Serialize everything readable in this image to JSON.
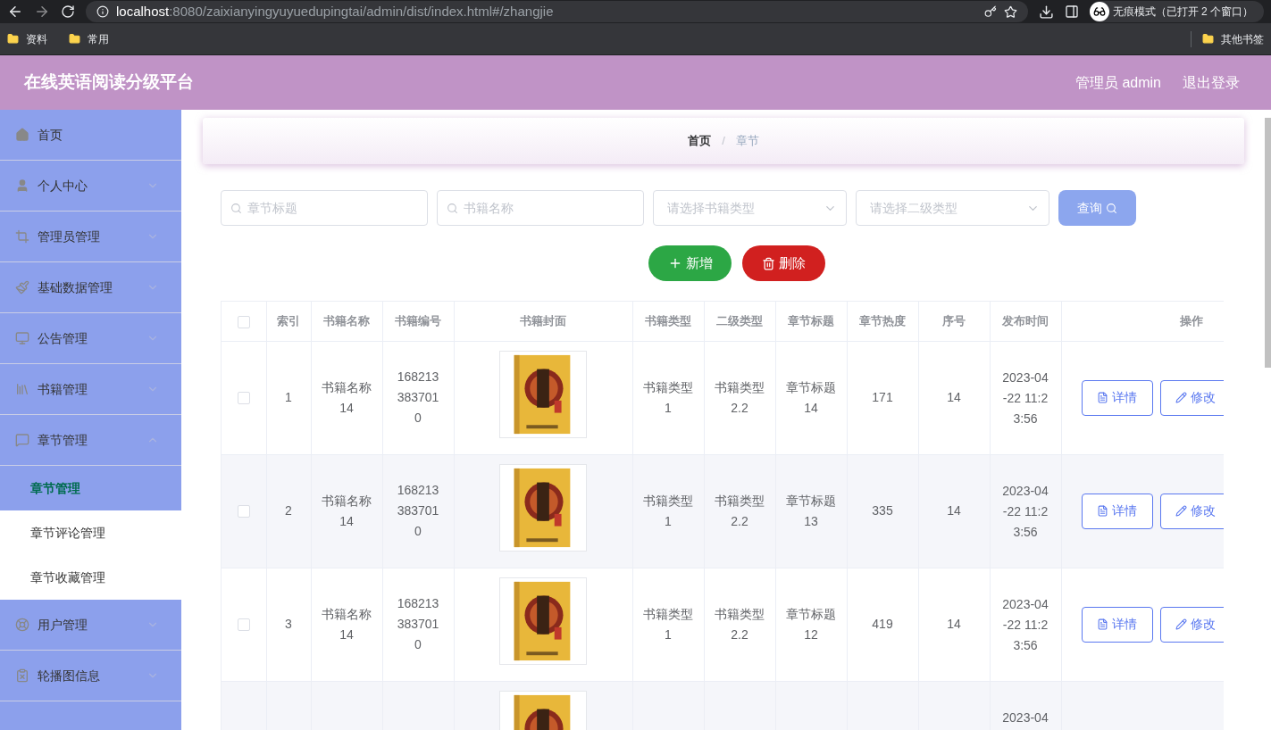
{
  "browser": {
    "url_host": "localhost",
    "url_rest": ":8080/zaixianyingyuyuedupingtai/admin/dist/index.html#/zhangjie",
    "incognito": "无痕模式（已打开 2 个窗口）",
    "bookmarks": [
      "资料",
      "常用"
    ],
    "other_bookmarks": "其他书签"
  },
  "header": {
    "title": "在线英语阅读分级平台",
    "user": "管理员 admin",
    "logout": "退出登录"
  },
  "sidebar": {
    "items": [
      {
        "label": "首页"
      },
      {
        "label": "个人中心",
        "expanded": false
      },
      {
        "label": "管理员管理",
        "expanded": false
      },
      {
        "label": "基础数据管理",
        "expanded": false
      },
      {
        "label": "公告管理",
        "expanded": false
      },
      {
        "label": "书籍管理",
        "expanded": false
      },
      {
        "label": "章节管理",
        "expanded": true,
        "children": [
          {
            "label": "章节管理",
            "selected": true
          },
          {
            "label": "章节评论管理",
            "selected": false
          },
          {
            "label": "章节收藏管理",
            "selected": false
          }
        ]
      },
      {
        "label": "用户管理",
        "expanded": false
      },
      {
        "label": "轮播图信息",
        "expanded": false
      }
    ]
  },
  "breadcrumb": {
    "items": [
      "首页",
      "章节"
    ],
    "separator": "/"
  },
  "filters": [
    {
      "kind": "search",
      "placeholder": "章节标题"
    },
    {
      "kind": "search",
      "placeholder": "书籍名称"
    },
    {
      "kind": "select",
      "placeholder": "请选择书籍类型"
    },
    {
      "kind": "select",
      "placeholder": "请选择二级类型"
    }
  ],
  "query_button": "查询",
  "actions": [
    {
      "kind": "add",
      "label": "新增"
    },
    {
      "kind": "delete",
      "label": "删除"
    }
  ],
  "table": {
    "select_all_checked": false,
    "columns": [
      "索引",
      "书籍名称",
      "书籍编号",
      "书籍封面",
      "书籍类型",
      "二级类型",
      "章节标题",
      "章节热度",
      "序号",
      "发布时间",
      "操作"
    ],
    "rows": [
      {
        "checked": false,
        "index": "1",
        "book_name": "书籍名称14",
        "book_code": "1682133837010",
        "cover": {
          "kind": "picture"
        },
        "book_type": "书籍类型1",
        "sub_type": "书籍类型2.2",
        "chapter_title": "章节标题14",
        "heat": "171",
        "order": "14",
        "time": "2023-04-22 11:23:56",
        "buttons": [
          "详情",
          "修改"
        ]
      },
      {
        "checked": false,
        "index": "2",
        "book_name": "书籍名称14",
        "book_code": "1682133837010",
        "cover": {
          "kind": "picture"
        },
        "book_type": "书籍类型1",
        "sub_type": "书籍类型2.2",
        "chapter_title": "章节标题13",
        "heat": "335",
        "order": "14",
        "time": "2023-04-22 11:23:56",
        "buttons": [
          "详情",
          "修改"
        ]
      },
      {
        "checked": false,
        "index": "3",
        "book_name": "书籍名称14",
        "book_code": "1682133837010",
        "cover": {
          "kind": "picture"
        },
        "book_type": "书籍类型1",
        "sub_type": "书籍类型2.2",
        "chapter_title": "章节标题12",
        "heat": "419",
        "order": "14",
        "time": "2023-04-22 11:23:56",
        "buttons": [
          "详情",
          "修改"
        ]
      },
      {
        "cover": {
          "kind": "picture"
        },
        "time": "2023-04"
      }
    ]
  }
}
